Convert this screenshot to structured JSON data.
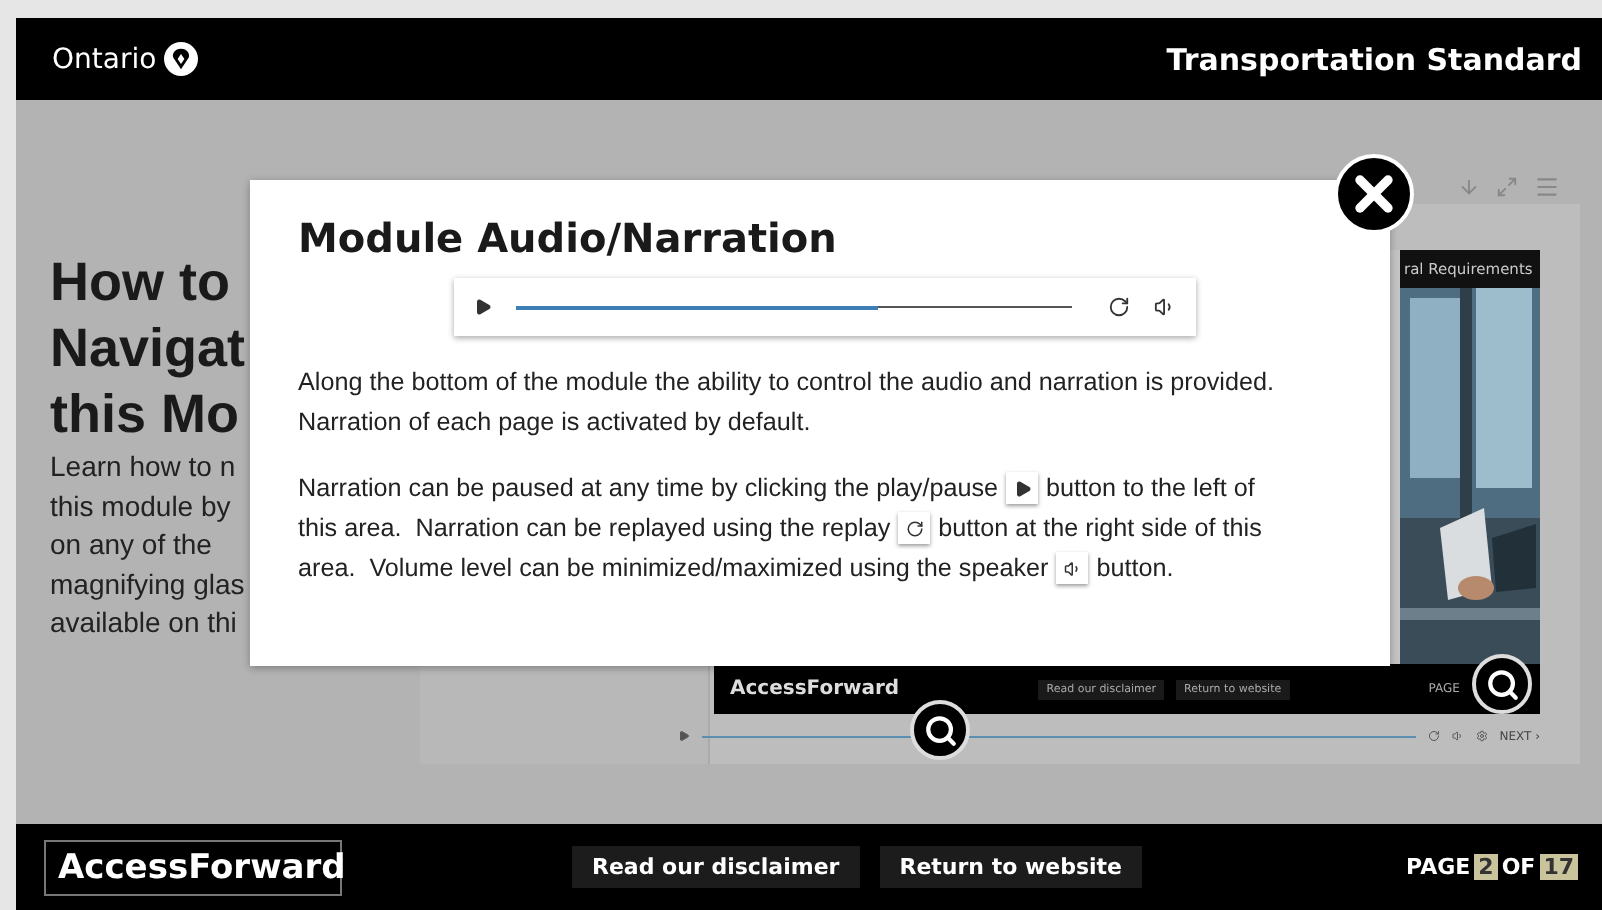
{
  "header": {
    "brand": "Ontario",
    "title": "Transportation Standard"
  },
  "background": {
    "heading_lines": [
      "How to",
      "Navigat",
      "this Mo"
    ],
    "intro_lines": [
      "Learn how to n",
      "this module by",
      "on any of the",
      "magnifying glas",
      "available on thi"
    ],
    "slide": {
      "header": "ral Requirements",
      "logo": "AccessForward",
      "buttons": [
        "Read our disclaimer",
        "Return to website"
      ],
      "page_label": "PAGE"
    },
    "player": {
      "next": "NEXT ›"
    }
  },
  "modal": {
    "title": "Module Audio/Narration",
    "player": {
      "level": 0.65
    },
    "paragraphs": [
      [
        [
          {
            "kind": "text",
            "text": "Along the bottom of the module the ability to control the audio and narration is provided."
          }
        ],
        [
          {
            "kind": "text",
            "text": "Narration of each page is activated by default."
          }
        ]
      ],
      [
        [
          {
            "kind": "text",
            "text": "Narration can be paused at any time by clicking the play/pause"
          },
          {
            "kind": "play"
          },
          {
            "kind": "text",
            "text": "button to the left of"
          }
        ],
        [
          {
            "kind": "text",
            "text": "this area.  Narration can be replayed using the replay"
          },
          {
            "kind": "replay"
          },
          {
            "kind": "text",
            "text": "button at the right side of this"
          }
        ],
        [
          {
            "kind": "text",
            "text": "area.  Volume level can be minimized/maximized using the speaker"
          },
          {
            "kind": "speaker"
          },
          {
            "kind": "text",
            "text": "button."
          }
        ]
      ]
    ]
  },
  "footer": {
    "logo": "AccessForward",
    "buttons": [
      "Read our disclaimer",
      "Return to website"
    ],
    "page": {
      "label": "PAGE",
      "current": "2",
      "of": "OF",
      "total": "17"
    }
  }
}
